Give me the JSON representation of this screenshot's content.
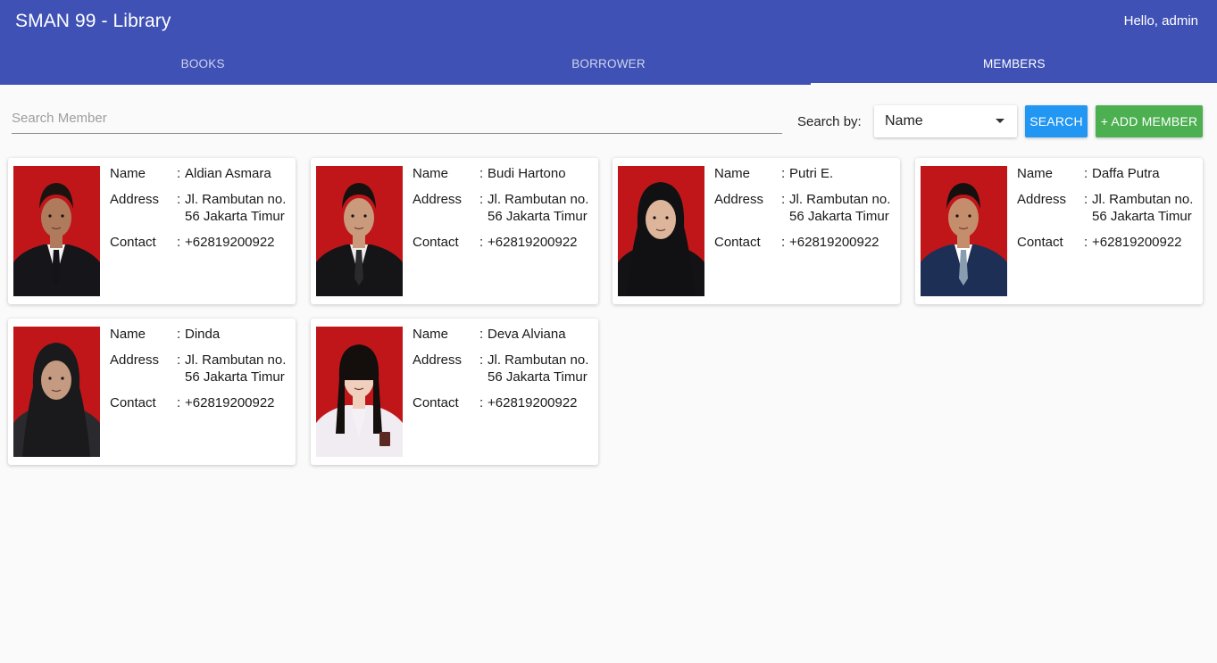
{
  "app": {
    "title": "SMAN 99 - Library",
    "greeting": "Hello, admin"
  },
  "tabs": [
    {
      "label": "BOOKS",
      "active": false
    },
    {
      "label": "BORROWER",
      "active": false
    },
    {
      "label": "MEMBERS",
      "active": true
    }
  ],
  "search": {
    "placeholder": "Search Member",
    "value": ""
  },
  "search_by": {
    "label": "Search by:",
    "selected": "Name"
  },
  "buttons": {
    "search": "SEARCH",
    "add_member": "+ ADD MEMBER"
  },
  "labels": {
    "name": "Name",
    "address": "Address",
    "contact": "Contact",
    "sep": ":"
  },
  "members": [
    {
      "name": "Aldian Asmara",
      "address": "Jl. Rambutan no. 56 Jakarta Timur",
      "contact": "+62819200922"
    },
    {
      "name": "Budi Hartono",
      "address": "Jl. Rambutan no. 56 Jakarta Timur",
      "contact": "+62819200922"
    },
    {
      "name": "Putri E.",
      "address": "Jl. Rambutan no. 56 Jakarta Timur",
      "contact": "+62819200922"
    },
    {
      "name": "Daffa Putra",
      "address": "Jl. Rambutan no. 56 Jakarta Timur",
      "contact": "+62819200922"
    },
    {
      "name": "Dinda",
      "address": "Jl. Rambutan no. 56 Jakarta Timur",
      "contact": "+62819200922"
    },
    {
      "name": "Deva Alviana",
      "address": "Jl. Rambutan no. 56 Jakarta Timur",
      "contact": "+62819200922"
    }
  ],
  "colors": {
    "appbar": "#3f51b5",
    "search_button": "#2196f3",
    "add_button": "#4caf50",
    "photo_background": "#c0161a"
  }
}
